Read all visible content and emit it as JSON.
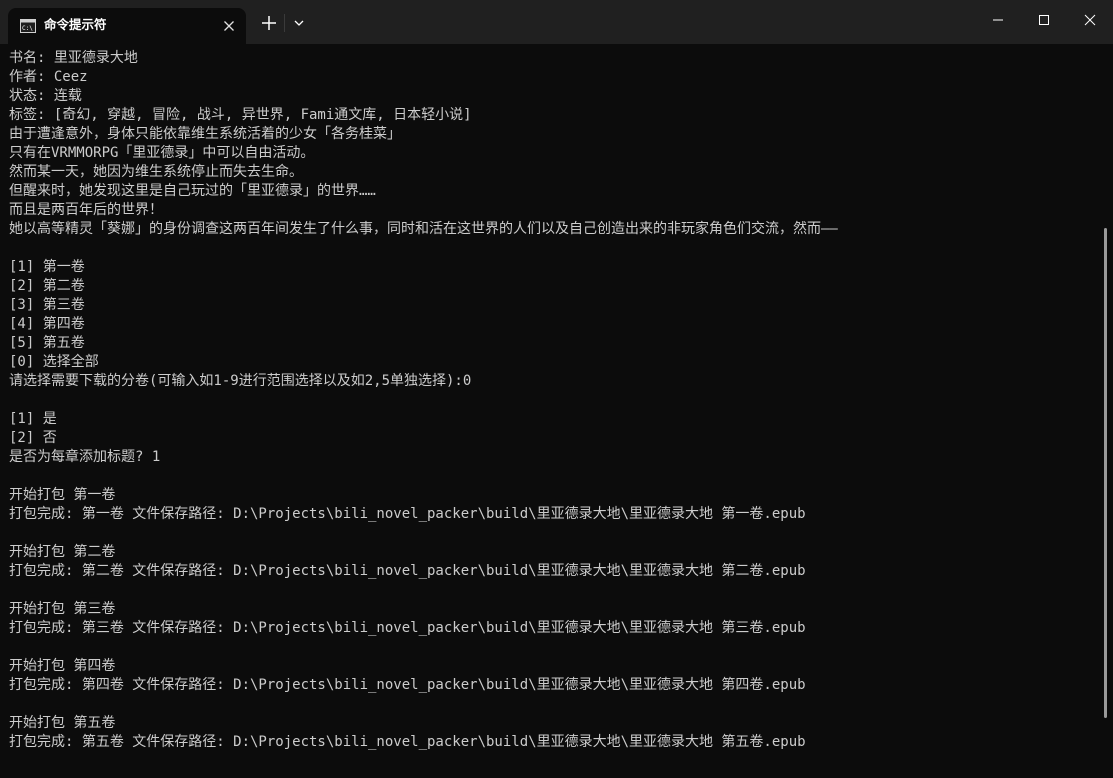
{
  "window": {
    "tab_title": "命令提示符",
    "tab_icon": "cmd-console-icon",
    "buttons": {
      "new_tab_icon": "plus-icon",
      "dropdown_icon": "chevron-down-icon",
      "minimize_icon": "minimize-icon",
      "maximize_icon": "maximize-icon",
      "close_icon": "close-icon"
    }
  },
  "console": {
    "lines": [
      "书名: 里亚德录大地",
      "作者: Ceez",
      "状态: 连载",
      "标签: [奇幻, 穿越, 冒险, 战斗, 异世界, Fami通文库, 日本轻小说]",
      "由于遭逢意外，身体只能依靠维生系统活着的少女「各务桂菜」",
      "只有在VRMMORPG「里亚德录」中可以自由活动。",
      "然而某一天，她因为维生系统停止而失去生命。",
      "但醒来时，她发现这里是自己玩过的「里亚德录」的世界……",
      "而且是两百年后的世界！",
      "她以高等精灵「葵娜」的身份调查这两百年间发生了什么事，同时和活在这世界的人们以及自己创造出来的非玩家角色们交流，然而——",
      "",
      "[1] 第一卷",
      "[2] 第二卷",
      "[3] 第三卷",
      "[4] 第四卷",
      "[5] 第五卷",
      "[0] 选择全部",
      "请选择需要下载的分卷(可输入如1-9进行范围选择以及如2,5单独选择):0",
      "",
      "[1] 是",
      "[2] 否",
      "是否为每章添加标题? 1",
      "",
      "开始打包 第一卷",
      "打包完成: 第一卷 文件保存路径: D:\\Projects\\bili_novel_packer\\build\\里亚德录大地\\里亚德录大地 第一卷.epub",
      "",
      "开始打包 第二卷",
      "打包完成: 第二卷 文件保存路径: D:\\Projects\\bili_novel_packer\\build\\里亚德录大地\\里亚德录大地 第二卷.epub",
      "",
      "开始打包 第三卷",
      "打包完成: 第三卷 文件保存路径: D:\\Projects\\bili_novel_packer\\build\\里亚德录大地\\里亚德录大地 第三卷.epub",
      "",
      "开始打包 第四卷",
      "打包完成: 第四卷 文件保存路径: D:\\Projects\\bili_novel_packer\\build\\里亚德录大地\\里亚德录大地 第四卷.epub",
      "",
      "开始打包 第五卷",
      "打包完成: 第五卷 文件保存路径: D:\\Projects\\bili_novel_packer\\build\\里亚德录大地\\里亚德录大地 第五卷.epub"
    ]
  },
  "colors": {
    "background": "#0c0c0c",
    "titlebar": "#202020",
    "text": "#cccccc"
  }
}
